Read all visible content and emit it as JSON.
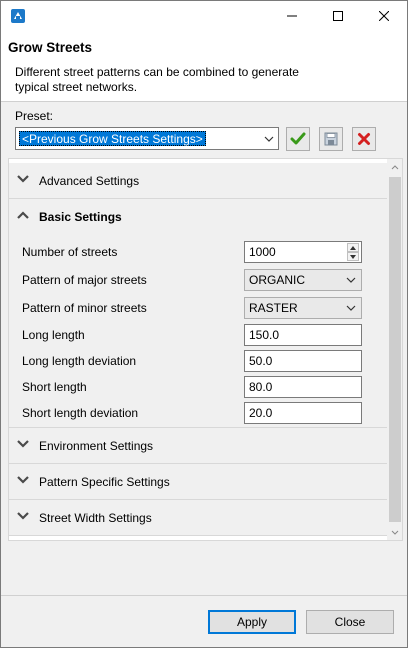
{
  "window": {
    "minimize_symbol": "—",
    "maximize_symbol": "☐",
    "close_symbol": "✕"
  },
  "header": {
    "title": "Grow Streets",
    "description": "Different street patterns can be combined to generate typical street networks."
  },
  "preset": {
    "label": "Preset:",
    "value": "<Previous Grow Streets Settings>"
  },
  "sections": {
    "advanced": {
      "label": "Advanced Settings",
      "expanded": false
    },
    "basic": {
      "label": "Basic Settings",
      "expanded": true
    },
    "environment": {
      "label": "Environment Settings",
      "expanded": false
    },
    "pattern": {
      "label": "Pattern Specific Settings",
      "expanded": false
    },
    "width": {
      "label": "Street Width Settings",
      "expanded": false
    }
  },
  "basic": {
    "number_of_streets": {
      "label": "Number of streets",
      "value": "1000"
    },
    "major_pattern": {
      "label": "Pattern of major streets",
      "value": "ORGANIC"
    },
    "minor_pattern": {
      "label": "Pattern of minor streets",
      "value": "RASTER"
    },
    "long_length": {
      "label": "Long length",
      "value": "150.0"
    },
    "long_length_deviation": {
      "label": "Long length deviation",
      "value": "50.0"
    },
    "short_length": {
      "label": "Short length",
      "value": "80.0"
    },
    "short_length_deviation": {
      "label": "Short length deviation",
      "value": "20.0"
    }
  },
  "buttons": {
    "apply": "Apply",
    "close": "Close"
  },
  "colors": {
    "selection": "#0078d7",
    "apply_check": "#3a9a1a",
    "delete_x": "#d42020",
    "app_icon": "#1c79c9"
  },
  "icons": {
    "app": "app-logo-icon",
    "apply_preset": "checkmark-icon",
    "save_preset": "floppy-disk-icon",
    "delete_preset": "delete-x-icon"
  }
}
